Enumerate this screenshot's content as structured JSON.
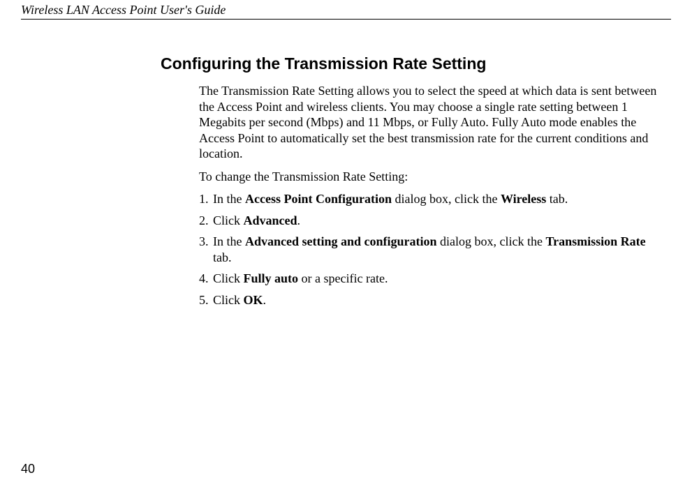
{
  "header": {
    "running_title": "Wireless LAN Access Point User's Guide"
  },
  "section": {
    "title": "Configuring the Transmission Rate Setting",
    "intro": "The Transmission Rate Setting allows you to select the speed at which data is sent between the Access Point and wireless clients. You may choose a single rate setting between 1 Megabits per second (Mbps) and 11 Mbps, or Fully Auto. Fully Auto mode enables the Access Point to automatically set the best transmission rate for the current conditions and location.",
    "lead_in": "To change the Transmission Rate Setting:",
    "steps": {
      "s1_a": "In the ",
      "s1_b": "Access Point Configuration",
      "s1_c": " dialog box, click the ",
      "s1_d": "Wireless",
      "s1_e": " tab.",
      "s2_a": "Click ",
      "s2_b": "Advanced",
      "s2_c": ".",
      "s3_a": "In the ",
      "s3_b": "Advanced setting and configuration",
      "s3_c": " dialog box, click the ",
      "s3_d": "Transmission Rate",
      "s3_e": " tab.",
      "s4_a": "Click ",
      "s4_b": "Fully auto",
      "s4_c": " or a specific rate.",
      "s5_a": "Click ",
      "s5_b": "OK",
      "s5_c": "."
    }
  },
  "page_number": "40"
}
